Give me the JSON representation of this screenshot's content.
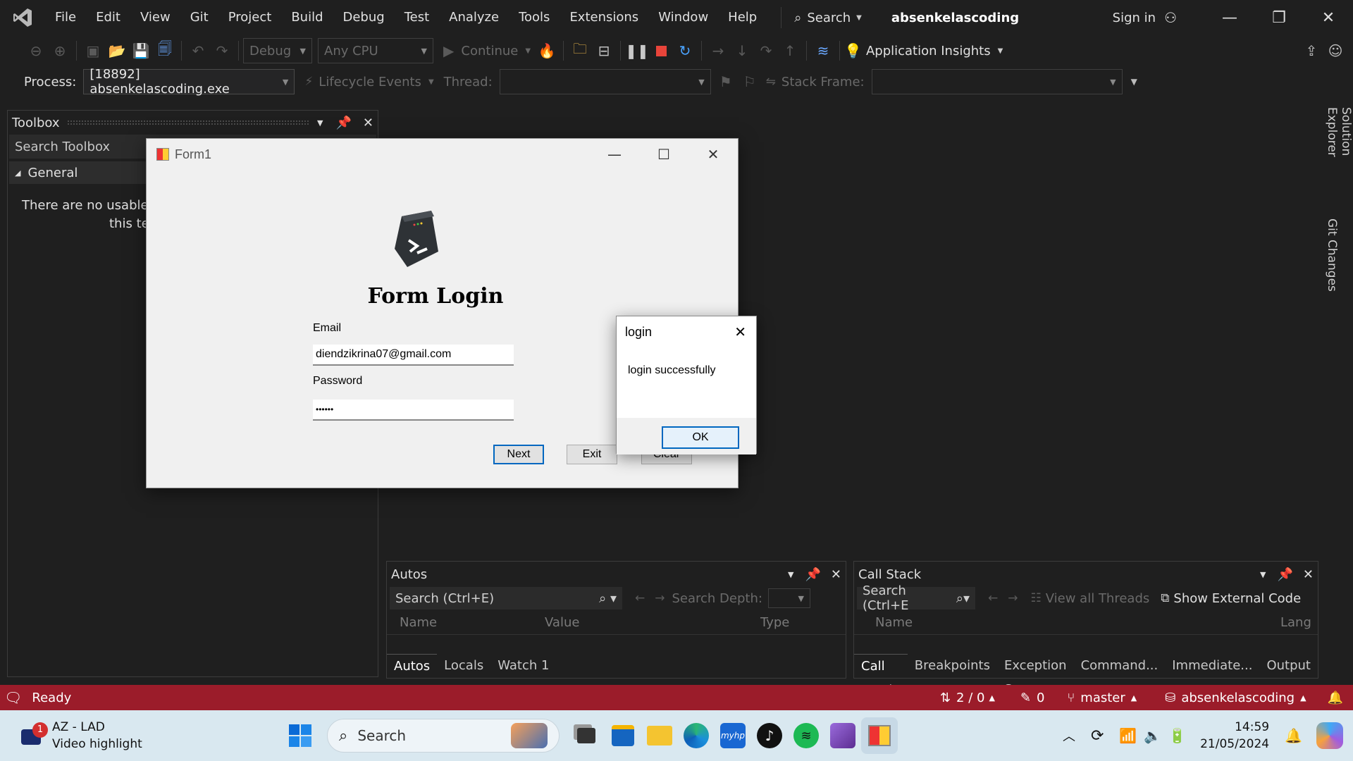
{
  "menubar": {
    "items": [
      "File",
      "Edit",
      "View",
      "Git",
      "Project",
      "Build",
      "Debug",
      "Test",
      "Analyze",
      "Tools",
      "Extensions",
      "Window",
      "Help"
    ],
    "search_label": "Search",
    "solution_name": "absenkelascoding",
    "sign_in": "Sign in"
  },
  "toolbar": {
    "config": "Debug",
    "platform": "Any CPU",
    "continue_label": "Continue",
    "app_insights": "Application Insights"
  },
  "debug_location": {
    "process_label": "Process:",
    "process_value": "[18892] absenkelascoding.exe",
    "lifecycle": "Lifecycle Events",
    "thread_label": "Thread:",
    "stack_frame_label": "Stack Frame:"
  },
  "toolbox": {
    "title": "Toolbox",
    "search_placeholder": "Search Toolbox",
    "group": "General",
    "empty_line1": "There are no usable co",
    "empty_line2": "this text"
  },
  "side_tabs": [
    "Solution Explorer",
    "Git Changes"
  ],
  "autos": {
    "title": "Autos",
    "search": "Search (Ctrl+E)",
    "search_depth": "Search Depth:",
    "columns": [
      "Name",
      "Value",
      "Type"
    ],
    "tabs": [
      "Autos",
      "Locals",
      "Watch 1"
    ]
  },
  "callstack": {
    "title": "Call Stack",
    "search": "Search (Ctrl+E",
    "view_threads": "View all Threads",
    "show_external": "Show External Code",
    "columns": [
      "Name",
      "Lang"
    ],
    "tabs": [
      "Call Stack",
      "Breakpoints",
      "Exception S...",
      "Command...",
      "Immediate...",
      "Output"
    ]
  },
  "statusbar": {
    "ready": "Ready",
    "changes": "2 / 0",
    "pending": "0",
    "branch": "master",
    "repo": "absenkelascoding"
  },
  "form1": {
    "title": "Form1",
    "heading": "Form Login",
    "email_label": "Email",
    "email_value": "diendzikrina07@gmail.com",
    "password_label": "Password",
    "password_value": "••••••",
    "next": "Next",
    "exit": "Exit",
    "clear": "Clear"
  },
  "msgbox": {
    "title": "login",
    "message": "login successfully",
    "ok": "OK"
  },
  "taskbar": {
    "weather_badge": "1",
    "weather_title": "AZ - LAD",
    "weather_sub": "Video highlight",
    "search": "Search",
    "time": "14:59",
    "date": "21/05/2024"
  },
  "colors": {
    "status_bar": "#9b1c2a",
    "taskbar": "#d9e8f0",
    "accent": "#0067c0"
  }
}
